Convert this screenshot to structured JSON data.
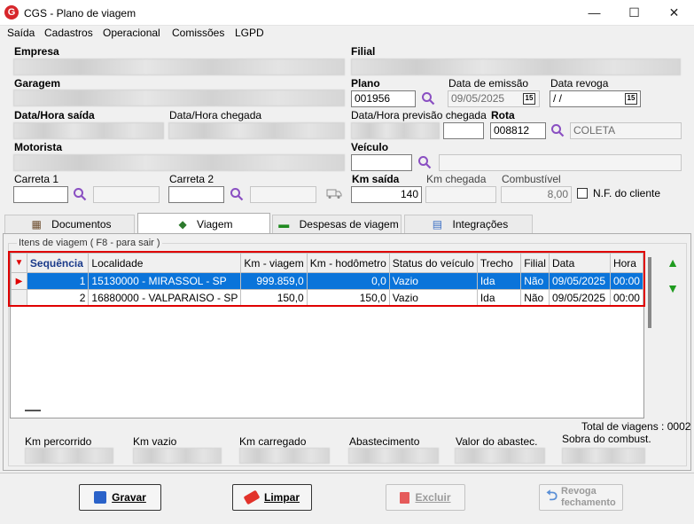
{
  "window": {
    "title": "CGS - Plano de viagem",
    "minimize": "—",
    "maximize": "☐",
    "close": "✕"
  },
  "menu": [
    "Saída",
    "Cadastros",
    "Operacional",
    "Comissões",
    "LGPD"
  ],
  "labels": {
    "empresa": "Empresa",
    "filial": "Filial",
    "garagem": "Garagem",
    "plano": "Plano",
    "data_emissao": "Data de emissão",
    "data_revoga": "Data revoga",
    "data_hora_saida": "Data/Hora saída",
    "data_hora_chegada": "Data/Hora chegada",
    "data_hora_previsao": "Data/Hora previsão chegada",
    "rota": "Rota",
    "motorista": "Motorista",
    "veiculo": "Veículo",
    "carreta1": "Carreta 1",
    "carreta2": "Carreta 2",
    "km_saida": "Km saída",
    "km_chegada": "Km chegada",
    "combustivel": "Combustível",
    "nf_cliente": "N.F. do cliente"
  },
  "values": {
    "plano": "001956",
    "data_emissao": "09/05/2025",
    "data_revoga": " /  /",
    "rota": "008812",
    "rota_desc": "COLETA",
    "km_saida": "140",
    "combustivel": "8,00",
    "nf_cliente_checked": false
  },
  "tabs": [
    "Documentos",
    "Viagem",
    "Despesas de viagem",
    "Integrações"
  ],
  "active_tab": "Viagem",
  "grid": {
    "group_label": "Itens de viagem ( F8 - para sair )",
    "columns": [
      "Sequência",
      "Localidade",
      "Km - viagem",
      "Km - hodômetro",
      "Status do veículo",
      "Trecho",
      "Filial",
      "Data",
      "Hora"
    ],
    "rows": [
      {
        "seq": "1",
        "localidade": "15130000 - MIRASSOL - SP",
        "km_viagem": "999.859,0",
        "km_hodometro": "0,0",
        "status": "Vazio",
        "trecho": "Ida",
        "filial": "Não",
        "data": "09/05/2025",
        "hora": "00:00",
        "selected": true
      },
      {
        "seq": "2",
        "localidade": "16880000 - VALPARAISO - SP",
        "km_viagem": "150,0",
        "km_hodometro": "150,0",
        "status": "Vazio",
        "trecho": "Ida",
        "filial": "Não",
        "data": "09/05/2025",
        "hora": "00:00",
        "selected": false
      }
    ]
  },
  "totals": {
    "total_viagens": "Total de viagens : 0002",
    "km_percorrido": "Km percorrido",
    "km_vazio": "Km vazio",
    "km_carregado": "Km carregado",
    "abastecimento": "Abastecimento",
    "valor_abastec": "Valor do abastec.",
    "sobra_combust": "Sobra do combust."
  },
  "buttons": {
    "gravar": "Gravar",
    "limpar": "Limpar",
    "excluir": "Excluir",
    "revoga1": "Revoga",
    "revoga2": "fechamento"
  },
  "colors": {
    "accent": "#d7262b",
    "selection": "#0a74da",
    "highlight_border": "#e00000"
  }
}
